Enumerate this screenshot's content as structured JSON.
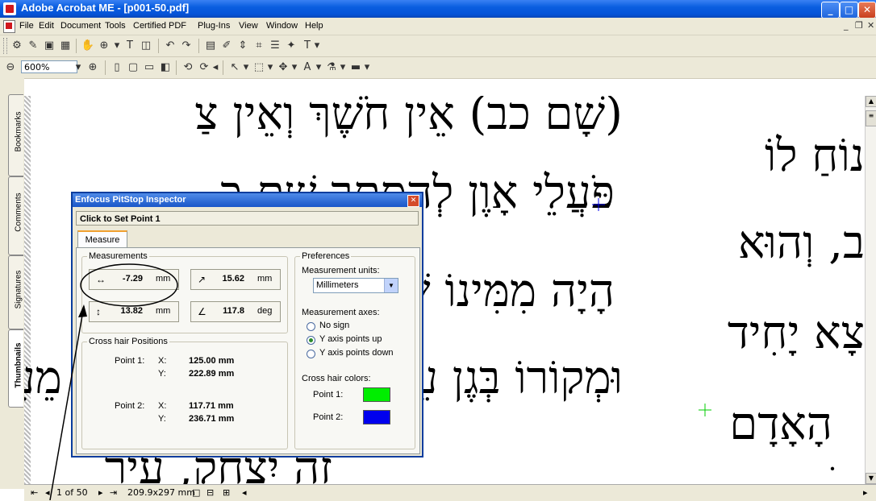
{
  "window": {
    "title": "Adobe Acrobat ME - [p001-50.pdf]",
    "controls": {
      "minimize": "_",
      "maximize": "□",
      "close": "✕"
    }
  },
  "menubar": {
    "items": [
      "File",
      "Edit",
      "Document",
      "Tools",
      "Certified PDF",
      "Plug-Ins",
      "View",
      "Window",
      "Help"
    ],
    "doc_controls": {
      "minimize": "_",
      "restore": "❐",
      "close": "✕"
    }
  },
  "zoom": {
    "value": "600%"
  },
  "nav_tabs": [
    "Bookmarks",
    "Comments",
    "Signatures",
    "Thumbnails"
  ],
  "document_text": {
    "left_lines": [
      "(שָׁם כב) אֵין חֹשֶׁךְ וְאֵין צַ",
      "פֹּעֲלֵי אָוֶן לְהִסָּתֵר שָׁם כִּ",
      "הָיָה מִמִּינוֹ שֶׁל אֱלֹהִים שֶׁהָ",
      "וּמְקוֹרוֹ בְּגֶן עֵדֶן שֶׁנֶּאֱמַר וְנָהָר יֹצֵא מֵעֵדֶן",
      "זֶה יִצְחָק, עִיר"
    ],
    "right_lines": [
      "נוֹחַ לוֹ",
      "ב, וְהוּא",
      "צָא יָחִיד",
      "הָאָדָם",
      "ׁ ,"
    ]
  },
  "statusbar": {
    "page": "1 of 50",
    "size": "209.9x297 mm"
  },
  "dialog": {
    "title": "Enfocus PitStop Inspector",
    "close": "✕",
    "status": "Click to Set Point 1",
    "tab": "Measure",
    "measurements": {
      "legend": "Measurements",
      "horizontal": {
        "value": "-7.29",
        "unit": "mm",
        "icon": "↔"
      },
      "diagonal": {
        "value": "15.62",
        "unit": "mm",
        "icon": "↗"
      },
      "vertical": {
        "value": "13.82",
        "unit": "mm",
        "icon": "↕"
      },
      "angle": {
        "value": "117.8",
        "unit": "deg",
        "icon": "∠"
      }
    },
    "crosshair": {
      "legend": "Cross hair Positions",
      "point1": {
        "label": "Point 1:",
        "x_label": "X:",
        "y_label": "Y:",
        "x": "125.00 mm",
        "y": "222.89 mm"
      },
      "point2": {
        "label": "Point 2:",
        "x_label": "X:",
        "y_label": "Y:",
        "x": "117.71 mm",
        "y": "236.71 mm"
      }
    },
    "preferences": {
      "legend": "Preferences",
      "units_label": "Measurement units:",
      "units_value": "Millimeters",
      "axes_label": "Measurement axes:",
      "axes_options": [
        {
          "label": "No sign",
          "selected": false
        },
        {
          "label": "Y axis points up",
          "selected": true
        },
        {
          "label": "Y axis points down",
          "selected": false
        }
      ],
      "colors_label": "Cross hair colors:",
      "point1_label": "Point 1:",
      "point2_label": "Point 2:",
      "point1_color": "#00ee00",
      "point2_color": "#0000ee"
    }
  }
}
